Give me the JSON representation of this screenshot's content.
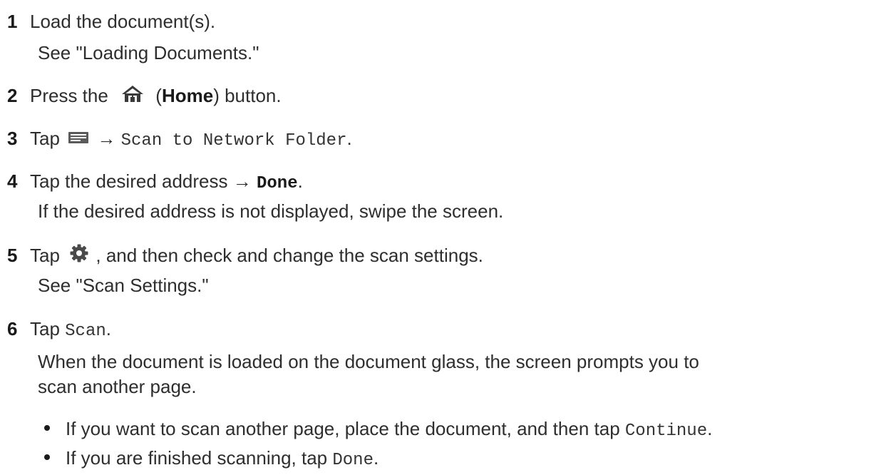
{
  "steps": [
    {
      "num": "1",
      "text": "Load the document(s).",
      "note": "See \"Loading Documents.\""
    },
    {
      "num": "2",
      "pre": "Press the",
      "open": "(",
      "bold": "Home",
      "post": ") button.",
      "icon": "home-icon"
    },
    {
      "num": "3",
      "pre": "Tap",
      "arrow": "→",
      "mono": "Scan to Network Folder",
      "end": ".",
      "icon": "scan-menu-icon"
    },
    {
      "num": "4",
      "pre": "Tap the desired address",
      "arrow": "→",
      "mono": "Done",
      "end": ".",
      "note": "If the desired address is not displayed, swipe the screen."
    },
    {
      "num": "5",
      "pre": "Tap",
      "post": ", and then check and change the scan settings.",
      "note": "See \"Scan Settings.\"",
      "icon": "gear-icon"
    },
    {
      "num": "6",
      "pre": "Tap",
      "mono": "Scan",
      "end": ".",
      "note1": "When the document is loaded on the document glass, the screen prompts you to",
      "note2": "scan another page.",
      "bullets": [
        {
          "text": "If you want to scan another page, place the document, and then tap",
          "mono": "Continue",
          "end": "."
        },
        {
          "text": "If you are finished scanning, tap",
          "mono": "Done",
          "end": "."
        }
      ]
    }
  ],
  "colors": {
    "text": "#2e2e2e",
    "icon": "#3a3a3a",
    "gear": "#4a4a4a"
  }
}
